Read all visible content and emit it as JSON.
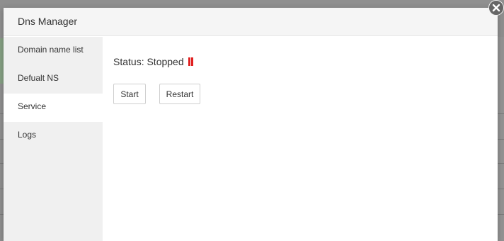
{
  "dialog": {
    "title": "Dns Manager",
    "close_icon": "close-icon"
  },
  "sidebar": {
    "items": [
      {
        "label": "Domain name list",
        "active": false
      },
      {
        "label": "Defualt NS",
        "active": false
      },
      {
        "label": "Service",
        "active": true
      },
      {
        "label": "Logs",
        "active": false
      }
    ]
  },
  "service": {
    "status_label": "Status: Stopped",
    "status_icon": "pause-icon",
    "status_color": "#e02020",
    "start_label": "Start",
    "restart_label": "Restart"
  },
  "colors": {
    "header_bg": "#f5f5f5",
    "sidebar_bg": "#f0f0f0",
    "active_item_bg": "#ffffff",
    "backdrop": "#8f8f8f"
  }
}
